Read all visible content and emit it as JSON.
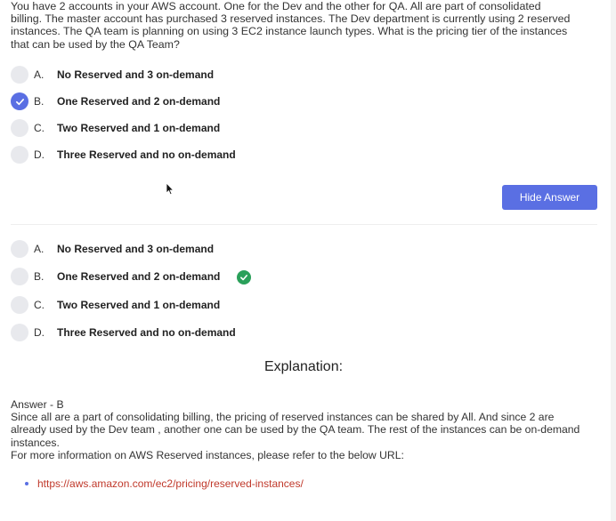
{
  "question": {
    "text": "You have 2 accounts in your AWS account. One for the Dev and the other for QA. All are part of consolidated billing. The master account has purchased 3 reserved instances. The Dev department is currently using 2 reserved instances. The QA team is planning on using 3 EC2 instance launch types. What is the pricing tier of the instances that can be used by the QA Team?"
  },
  "options": [
    {
      "letter": "A.",
      "text": "No Reserved and 3 on-demand"
    },
    {
      "letter": "B.",
      "text": "One Reserved and 2 on-demand"
    },
    {
      "letter": "C.",
      "text": "Two Reserved and 1 on-demand"
    },
    {
      "letter": "D.",
      "text": "Three Reserved and no on-demand"
    }
  ],
  "selected_option": "B.",
  "correct_option": "B.",
  "hide_answer_label": "Hide Answer",
  "explanation": {
    "title": "Explanation:",
    "answer_line": "Answer - B",
    "body": "Since all are a part of consolidating billing, the pricing of reserved instances can be shared by All. And since 2 are already used by the Dev team , another one can be used by the QA team. The rest of the instances can be on-demand instances.",
    "more_info": "For more information on AWS Reserved instances, please refer to the below URL:",
    "link": "https://aws.amazon.com/ec2/pricing/reserved-instances/"
  },
  "colors": {
    "accent": "#5a6fe3",
    "correct": "#2aa05a",
    "link": "#c0392b"
  },
  "icons": {
    "checkmark": "check-icon",
    "correct": "check-circle-icon",
    "cursor": "mouse-pointer-icon"
  }
}
